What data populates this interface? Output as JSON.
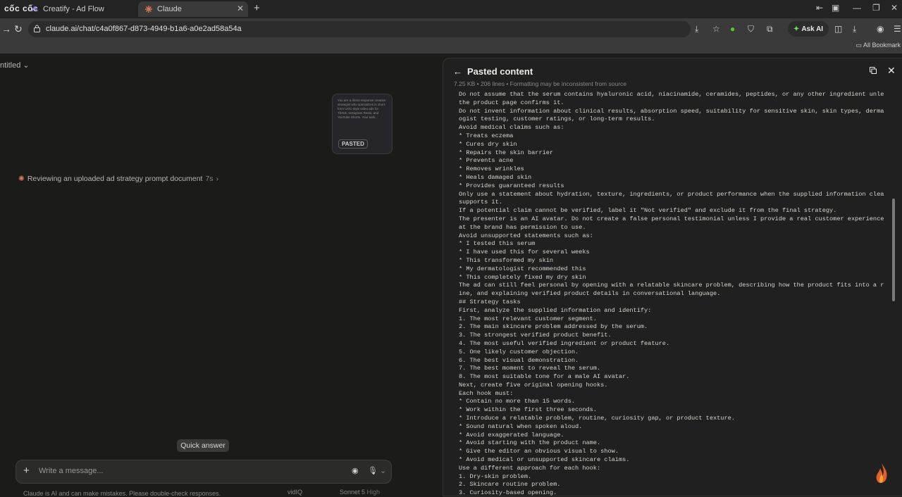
{
  "browser": {
    "brand": "cốc cốc",
    "tabs": [
      {
        "title": "Creatify - Ad Flow",
        "active": false
      },
      {
        "title": "Claude",
        "active": true
      }
    ],
    "url": "claude.ai/chat/c4a0f867-d873-4949-b1a6-a0e2ad58a54a",
    "ask_ai_label": "Ask AI",
    "bookmarks_label": "All Bookmark"
  },
  "chat": {
    "title": "ntitled",
    "attachment_preview": "You are a direct-response creative strategist who specializes in short-form UGC-style video ads for TikTok, Instagram Reels, and YouTube Shorts. Your task...",
    "attachment_badge": "PASTED",
    "status_text": "Reviewing an uploaded ad strategy prompt document",
    "status_time": "7s",
    "quick_answer": "Quick answer",
    "input_placeholder": "Write a message...",
    "footer": "Claude is AI and can make mistakes. Please double-check responses.",
    "footer_extra": "vidIQ",
    "model": "Sonnet 5",
    "effort": "High"
  },
  "panel": {
    "title": "Pasted content",
    "meta": "7.25 KB  •  206 lines  •  Formatting may be inconsistent from source",
    "lines": [
      "Do not assume that the serum contains hyaluronic acid, niacinamide, ceramides, peptides, or any other ingredient unless",
      "the product page confirms it.",
      "Do not invent information about clinical results, absorption speed, suitability for sensitive skin, skin types, dermatol",
      "ogist testing, customer ratings, or long-term results.",
      "Avoid medical claims such as:",
      "* Treats eczema",
      "* Cures dry skin",
      "* Repairs the skin barrier",
      "* Prevents acne",
      "* Removes wrinkles",
      "* Heals damaged skin",
      "* Provides guaranteed results",
      "Only use a statement about hydration, texture, ingredients, or product performance when the supplied information clearly",
      "supports it.",
      "If a potential claim cannot be verified, label it \"Not verified\" and exclude it from the final strategy.",
      "The presenter is an AI avatar. Do not create a false personal testimonial unless I provide a real customer experience th",
      "at the brand has permission to use.",
      "Avoid unsupported statements such as:",
      "* I tested this serum",
      "* I have used this for several weeks",
      "* This transformed my skin",
      "* My dermatologist recommended this",
      "* This completely fixed my dry skin",
      "The ad can still feel personal by opening with a relatable skincare problem, describing how the product fits into a rout",
      "ine, and explaining verified product details in conversational language.",
      "## Strategy tasks",
      "First, analyze the supplied information and identify:",
      "1. The most relevant customer segment.",
      "2. The main skincare problem addressed by the serum.",
      "3. The strongest verified product benefit.",
      "4. The most useful verified ingredient or product feature.",
      "5. One likely customer objection.",
      "6. The best visual demonstration.",
      "7. The best moment to reveal the serum.",
      "8. The most suitable tone for a male AI avatar.",
      "Next, create five original opening hooks.",
      "Each hook must:",
      "* Contain no more than 15 words.",
      "* Work within the first three seconds.",
      "* Introduce a relatable problem, routine, curiosity gap, or product texture.",
      "* Sound natural when spoken aloud.",
      "* Avoid exaggerated language.",
      "* Avoid starting with the product name.",
      "* Give the editor an obvious visual to show.",
      "* Avoid medical or unsupported skincare claims.",
      "Use a different approach for each hook:",
      "1. Dry-skin problem.",
      "2. Skincare routine problem.",
      "3. Curiosity-based opening."
    ]
  },
  "colors": {
    "accent": "#d97757",
    "background": "#1b1b1a",
    "panel": "#202020"
  }
}
